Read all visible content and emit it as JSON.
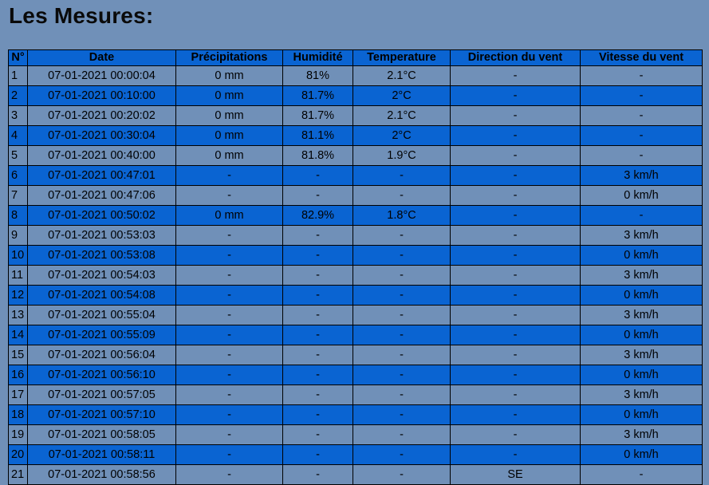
{
  "page": {
    "title": "Les Mesures:"
  },
  "table": {
    "headers": [
      "N°",
      "Date",
      "Précipitations",
      "Humidité",
      "Temperature",
      "Direction du vent",
      "Vitesse du vent"
    ],
    "rows": [
      [
        "1",
        "07-01-2021 00:00:04",
        "0 mm",
        "81%",
        "2.1°C",
        "-",
        "-"
      ],
      [
        "2",
        "07-01-2021 00:10:00",
        "0 mm",
        "81.7%",
        "2°C",
        "-",
        "-"
      ],
      [
        "3",
        "07-01-2021 00:20:02",
        "0 mm",
        "81.7%",
        "2.1°C",
        "-",
        "-"
      ],
      [
        "4",
        "07-01-2021 00:30:04",
        "0 mm",
        "81.1%",
        "2°C",
        "-",
        "-"
      ],
      [
        "5",
        "07-01-2021 00:40:00",
        "0 mm",
        "81.8%",
        "1.9°C",
        "-",
        "-"
      ],
      [
        "6",
        "07-01-2021 00:47:01",
        "-",
        "-",
        "-",
        "-",
        "3 km/h"
      ],
      [
        "7",
        "07-01-2021 00:47:06",
        "-",
        "-",
        "-",
        "-",
        "0 km/h"
      ],
      [
        "8",
        "07-01-2021 00:50:02",
        "0 mm",
        "82.9%",
        "1.8°C",
        "-",
        "-"
      ],
      [
        "9",
        "07-01-2021 00:53:03",
        "-",
        "-",
        "-",
        "-",
        "3 km/h"
      ],
      [
        "10",
        "07-01-2021 00:53:08",
        "-",
        "-",
        "-",
        "-",
        "0 km/h"
      ],
      [
        "11",
        "07-01-2021 00:54:03",
        "-",
        "-",
        "-",
        "-",
        "3 km/h"
      ],
      [
        "12",
        "07-01-2021 00:54:08",
        "-",
        "-",
        "-",
        "-",
        "0 km/h"
      ],
      [
        "13",
        "07-01-2021 00:55:04",
        "-",
        "-",
        "-",
        "-",
        "3 km/h"
      ],
      [
        "14",
        "07-01-2021 00:55:09",
        "-",
        "-",
        "-",
        "-",
        "0 km/h"
      ],
      [
        "15",
        "07-01-2021 00:56:04",
        "-",
        "-",
        "-",
        "-",
        "3 km/h"
      ],
      [
        "16",
        "07-01-2021 00:56:10",
        "-",
        "-",
        "-",
        "-",
        "0 km/h"
      ],
      [
        "17",
        "07-01-2021 00:57:05",
        "-",
        "-",
        "-",
        "-",
        "3 km/h"
      ],
      [
        "18",
        "07-01-2021 00:57:10",
        "-",
        "-",
        "-",
        "-",
        "0 km/h"
      ],
      [
        "19",
        "07-01-2021 00:58:05",
        "-",
        "-",
        "-",
        "-",
        "3 km/h"
      ],
      [
        "20",
        "07-01-2021 00:58:11",
        "-",
        "-",
        "-",
        "-",
        "0 km/h"
      ],
      [
        "21",
        "07-01-2021 00:58:56",
        "-",
        "-",
        "-",
        "SE",
        "-"
      ]
    ]
  },
  "colors": {
    "page_background": "#7090b8",
    "header_background": "#0a64d2",
    "row_odd": "#7090b8",
    "row_even": "#0a64d2"
  }
}
